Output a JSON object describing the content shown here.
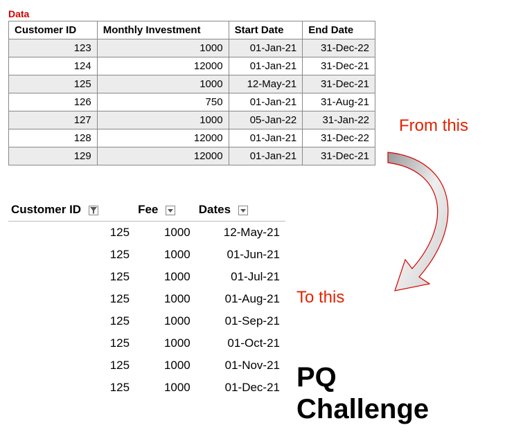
{
  "labels": {
    "data_heading": "Data",
    "from_this": "From this",
    "to_this": "To this",
    "pq": "PQ",
    "challenge": "Challenge"
  },
  "top_table": {
    "headers": [
      "Customer ID",
      "Monthly Investment",
      "Start Date",
      "End Date"
    ],
    "rows": [
      {
        "customer_id": "123",
        "monthly_investment": "1000",
        "start_date": "01-Jan-21",
        "end_date": "31-Dec-22"
      },
      {
        "customer_id": "124",
        "monthly_investment": "12000",
        "start_date": "01-Jan-21",
        "end_date": "31-Dec-21"
      },
      {
        "customer_id": "125",
        "monthly_investment": "1000",
        "start_date": "12-May-21",
        "end_date": "31-Dec-21"
      },
      {
        "customer_id": "126",
        "monthly_investment": "750",
        "start_date": "01-Jan-21",
        "end_date": "31-Aug-21"
      },
      {
        "customer_id": "127",
        "monthly_investment": "1000",
        "start_date": "05-Jan-22",
        "end_date": "31-Jan-22"
      },
      {
        "customer_id": "128",
        "monthly_investment": "12000",
        "start_date": "01-Jan-21",
        "end_date": "31-Dec-22"
      },
      {
        "customer_id": "129",
        "monthly_investment": "12000",
        "start_date": "01-Jan-21",
        "end_date": "31-Dec-21"
      }
    ]
  },
  "bottom_table": {
    "headers": [
      "Customer ID",
      "Fee",
      "Dates"
    ],
    "rows": [
      {
        "customer_id": "125",
        "fee": "1000",
        "date": "12-May-21"
      },
      {
        "customer_id": "125",
        "fee": "1000",
        "date": "01-Jun-21"
      },
      {
        "customer_id": "125",
        "fee": "1000",
        "date": "01-Jul-21"
      },
      {
        "customer_id": "125",
        "fee": "1000",
        "date": "01-Aug-21"
      },
      {
        "customer_id": "125",
        "fee": "1000",
        "date": "01-Sep-21"
      },
      {
        "customer_id": "125",
        "fee": "1000",
        "date": "01-Oct-21"
      },
      {
        "customer_id": "125",
        "fee": "1000",
        "date": "01-Nov-21"
      },
      {
        "customer_id": "125",
        "fee": "1000",
        "date": "01-Dec-21"
      }
    ]
  }
}
